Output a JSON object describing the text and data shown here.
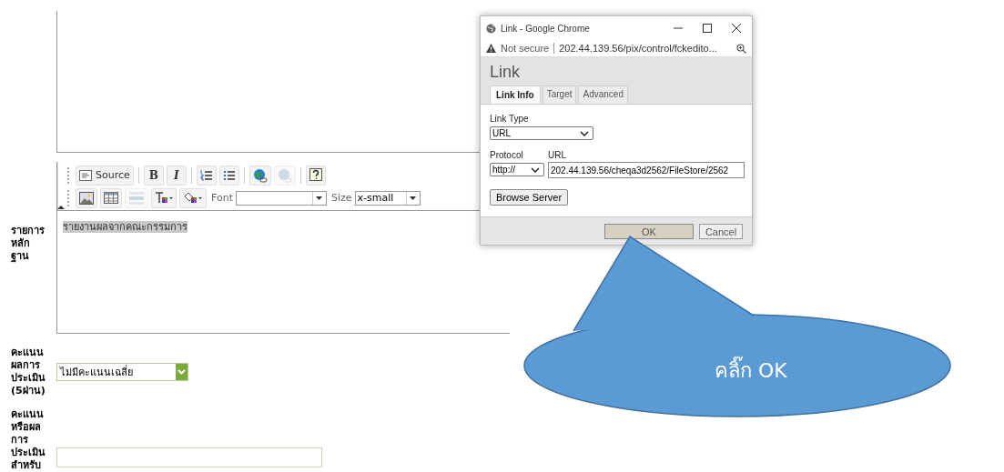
{
  "toolbar": {
    "rows": [
      [
        {
          "kind": "source",
          "label": "Source",
          "disabled": false
        },
        {
          "kind": "sep"
        },
        {
          "kind": "bold",
          "label": "B",
          "disabled": false
        },
        {
          "kind": "italic",
          "label": "I",
          "disabled": false
        },
        {
          "kind": "sep"
        },
        {
          "kind": "ordered-list",
          "disabled": false
        },
        {
          "kind": "bullet-list",
          "disabled": false
        },
        {
          "kind": "sep"
        },
        {
          "kind": "link",
          "disabled": false
        },
        {
          "kind": "unlink",
          "disabled": true
        },
        {
          "kind": "sep"
        },
        {
          "kind": "help",
          "disabled": false
        }
      ],
      [
        {
          "kind": "image",
          "disabled": false
        },
        {
          "kind": "table",
          "disabled": false
        },
        {
          "kind": "rule",
          "disabled": true
        },
        {
          "kind": "text-color",
          "disabled": false
        },
        {
          "kind": "bg-color",
          "disabled": false
        },
        {
          "kind": "font",
          "label": "Font"
        },
        {
          "kind": "size",
          "label": "Size",
          "value": "x-small"
        }
      ]
    ]
  },
  "fields": [
    {
      "kind": "editor",
      "label": "รายการ\nหลัก\nฐาน",
      "content": "รายงานผลจากคณะกรรมการ",
      "content_selected": true
    },
    {
      "kind": "select",
      "label": "คะแนน\nผลการ\nประเมิน\n(5ผ่าน)",
      "value": "ไม่มีคะแนนเฉลี่ย"
    },
    {
      "kind": "text",
      "label": "คะแนน\nหรือผล\nการ\nประเมิน\nสำหรับ"
    }
  ],
  "dialog": {
    "browser_title": "Link - Google Chrome",
    "security": "Not secure",
    "address": "202.44.139.56/pix/control/fckedito...",
    "heading": "Link",
    "tabs": [
      {
        "label": "Link Info",
        "selected": true
      },
      {
        "label": "Target",
        "selected": false
      },
      {
        "label": "Advanced",
        "selected": false
      }
    ],
    "link_type": {
      "label": "Link Type",
      "value": "URL"
    },
    "protocol": {
      "label": "Protocol",
      "value": "http://"
    },
    "url": {
      "label": "URL",
      "value": "202.44.139.56/cheqa3d2562/FileStore/2562"
    },
    "browse_button": "Browse Server",
    "buttons": [
      {
        "label": "OK",
        "focused": true
      },
      {
        "label": "Cancel",
        "focused": false
      }
    ]
  },
  "callout": {
    "text": "คลิ๊ก OK"
  }
}
